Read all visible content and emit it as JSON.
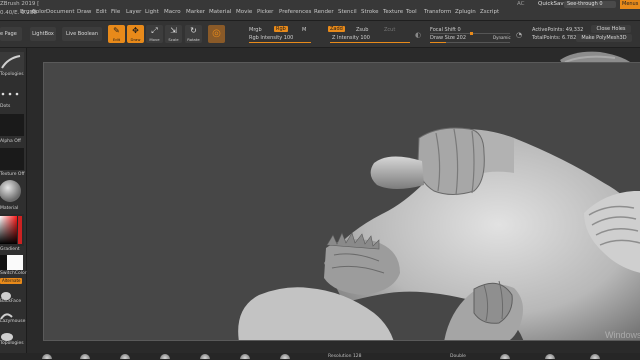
{
  "app": {
    "title": "ZBrush 2019 [",
    "info": "0.40/E. 0.238"
  },
  "menubar": {
    "items": [
      "Brush",
      "Color",
      "Document",
      "Draw",
      "Edit",
      "File",
      "Layer",
      "Light",
      "Macro",
      "Marker",
      "Material",
      "Movie",
      "Picker",
      "Preferences",
      "Render",
      "Stencil",
      "Stroke",
      "Texture",
      "Tool",
      "Transform",
      "Zplugin",
      "Zscript"
    ],
    "ac": "AC",
    "quicksave": "QuickSave",
    "seethrough": "See-through  0",
    "seethrough_value": 0,
    "menus": "Menus"
  },
  "shelf": {
    "home_page": "e Page",
    "lightbox": "LightBox",
    "live_boolean": "Live Boolean",
    "edit_icon": {
      "glyph": "✎",
      "label": "Edit"
    },
    "draw_icon": {
      "glyph": "✥",
      "label": "Draw"
    },
    "move_icon": {
      "glyph": "⤢",
      "label": "Move"
    },
    "scale_icon": {
      "glyph": "⇲",
      "label": "Scale"
    },
    "rotate_icon": {
      "glyph": "↻",
      "label": "Rotate"
    },
    "mrgb": "Mrgb",
    "rgb": "Rgb",
    "m": "M",
    "rgb_intensity": "Rgb Intensity 100",
    "zadd": "Zadd",
    "zsub": "Zsub",
    "zcut": "Zcut",
    "z_intensity": "Z Intensity 100",
    "focal_shift": "Focal Shift 0",
    "draw_size": "Draw Size 202",
    "dynamic": "Dynamic",
    "active_points": "ActivePoints: 49,332",
    "total_points": "TotalPoints: 6.782 Mil",
    "close_holes": "Close Holes",
    "make_polymesh": "Make PolyMesh3D"
  },
  "lefttray": {
    "topologies": "Topologies",
    "dots": "Dots",
    "alpha_off": "Alpha Off",
    "texture_off": "Texture Off",
    "material": "Material",
    "gradient": "Gradient",
    "switch_color": "SwitchColor",
    "alternate": "Alternate",
    "backface": "BackFace",
    "lazymouse": "Lazymouse",
    "topologies2": "Topologies"
  },
  "bottom": {
    "resolution": "Resolution 128",
    "double": "Double",
    "watermark": "Windows"
  },
  "colors": {
    "accent": "#e88a1a",
    "canvas": "#474747",
    "ui_bg": "#333333"
  }
}
